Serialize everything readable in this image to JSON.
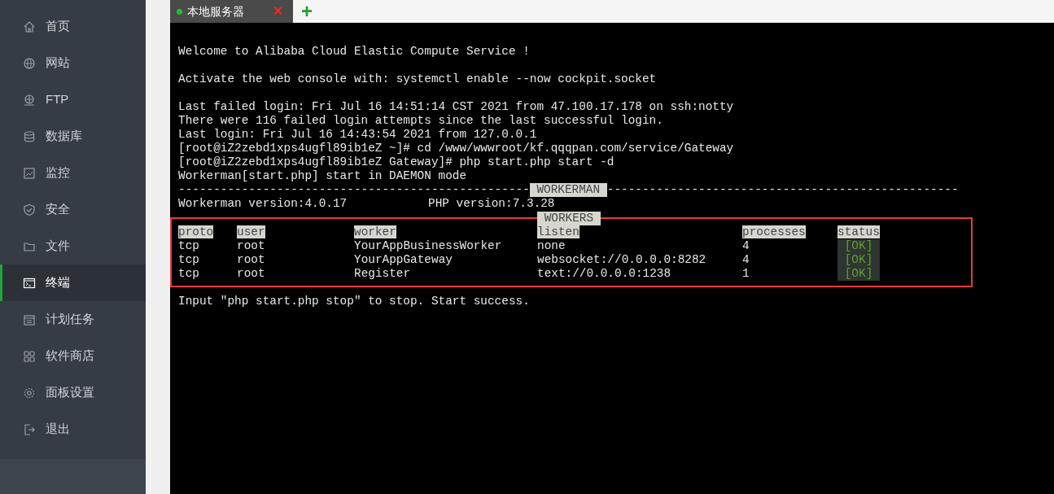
{
  "sidebar": {
    "items": [
      {
        "label": "首页",
        "selected": false
      },
      {
        "label": "网站",
        "selected": false
      },
      {
        "label": "FTP",
        "selected": false
      },
      {
        "label": "数据库",
        "selected": false
      },
      {
        "label": "监控",
        "selected": false
      },
      {
        "label": "安全",
        "selected": false
      },
      {
        "label": "文件",
        "selected": false
      },
      {
        "label": "终端",
        "selected": true
      },
      {
        "label": "计划任务",
        "selected": false
      },
      {
        "label": "软件商店",
        "selected": false
      },
      {
        "label": "面板设置",
        "selected": false
      },
      {
        "label": "退出",
        "selected": false
      }
    ]
  },
  "tabs": [
    {
      "label": "本地服务器",
      "selected": true,
      "connected": true,
      "close": "✕"
    }
  ],
  "new_tab": "+",
  "terminal": {
    "blocks": [
      [
        "Welcome to Alibaba Cloud Elastic Compute Service !"
      ],
      [
        "Activate the web console with: systemctl enable --now cockpit.socket"
      ],
      [
        "Last failed login: Fri Jul 16 14:51:14 CST 2021 from 47.100.17.178 on ssh:notty",
        "There were 116 failed login attempts since the last successful login.",
        "Last login: Fri Jul 16 14:43:54 2021 from 127.0.0.1",
        "[root@iZ2zebd1xps4ugfl89ib1eZ ~]# cd /www/wwwroot/kf.qqqpan.com/service/Gateway",
        "[root@iZ2zebd1xps4ugfl89ib1eZ Gateway]# php start.php start -d",
        "Workerman[start.php] start in DAEMON mode"
      ]
    ],
    "banner": {
      "left": "--------------------------------------------------",
      "label": "WORKERMAN",
      "right": "--------------------------------------------------"
    },
    "versions": [
      "Workerman version:4.0.17",
      "PHP version:7.3.28"
    ],
    "section_label": "WORKERS",
    "table": {
      "columns": [
        "proto",
        "user",
        "worker",
        "listen",
        "processes",
        "status"
      ],
      "rows": [
        {
          "cells": [
            "tcp",
            "root",
            "YourAppBusinessWorker",
            "none",
            "4"
          ],
          "status": "[OK]"
        },
        {
          "cells": [
            "tcp",
            "root",
            "YourAppGateway",
            "websocket://0.0.0.0:8282",
            "4"
          ],
          "status": "[OK]"
        },
        {
          "cells": [
            "tcp",
            "root",
            "Register",
            "text://0.0.0.0:1238",
            "1"
          ],
          "status": "[OK]"
        }
      ]
    },
    "footer": "Input \"php start.php stop\" to stop. Start success."
  }
}
